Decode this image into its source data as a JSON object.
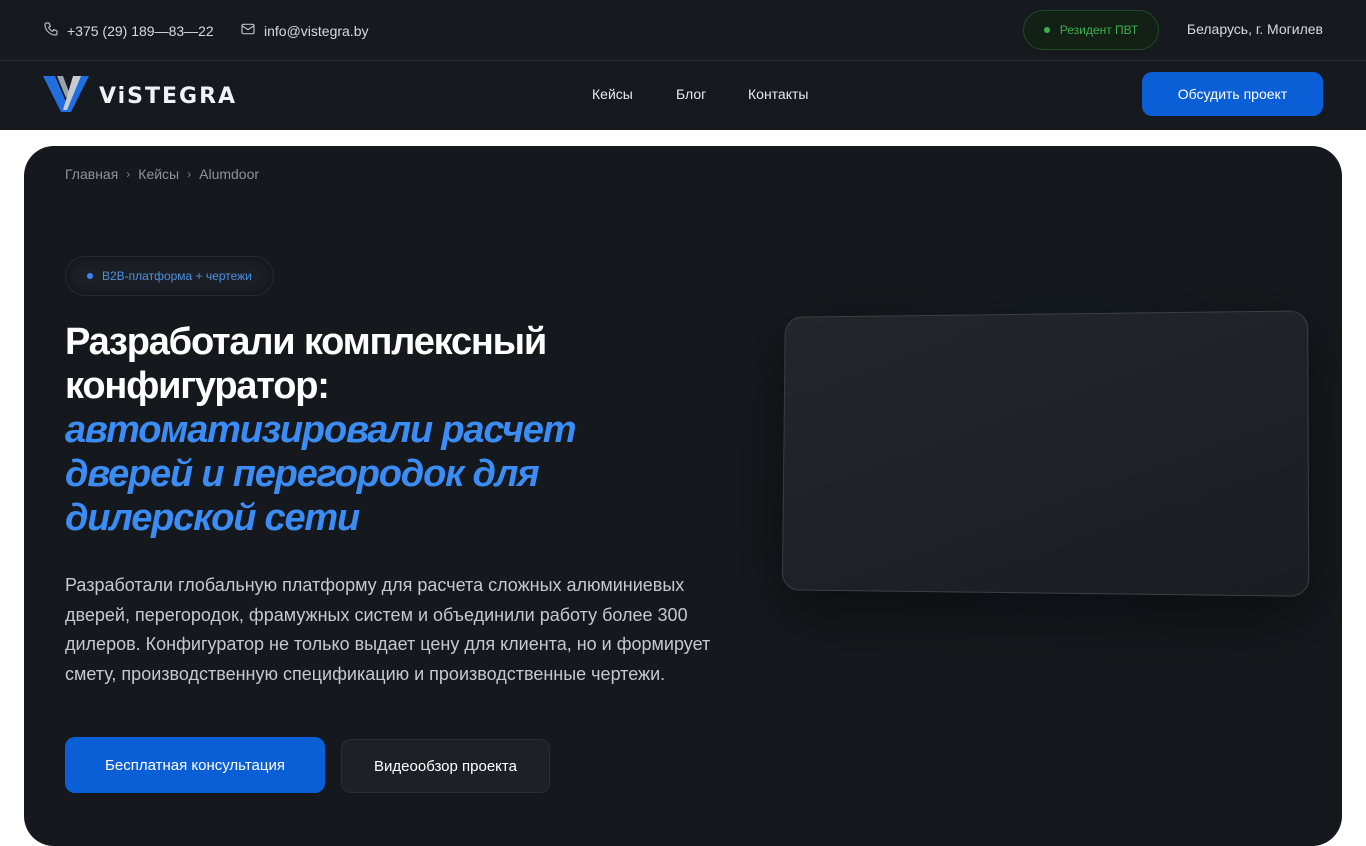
{
  "topbar": {
    "phone": "+375 (29) 189—83—22",
    "email": "info@vistegra.by",
    "resident_badge": "Резидент ПВТ",
    "location": "Беларусь, г. Могилев",
    "icons": {
      "phone": "phone-icon",
      "email": "mail-icon"
    },
    "colors": {
      "badge_text": "#3fae4f",
      "badge_dot": "#37b24d"
    }
  },
  "nav": {
    "logo_text": "ViSTEGRA",
    "links": [
      "Кейсы",
      "Блог",
      "Контакты"
    ],
    "cta_label": "Обсудить проект"
  },
  "hero": {
    "breadcrumb": [
      "Главная",
      "Кейсы",
      "Alumdoor"
    ],
    "tag": "B2B-платформа + чертежи",
    "title_white": "Разработали комплексный конфигуратор:",
    "title_blue": "автоматизировали расчет дверей и перегородок для дилерской сети",
    "description": "Разработали глобальную платформу для расчета сложных алюминиевых дверей, перегородок, фрамужных систем и объединили работу более 300 дилеров. Конфигуратор не только выдает цену для клиента, но и формирует смету, производственную спецификацию и производственные чертежи.",
    "btn_primary": "Бесплатная консультация",
    "btn_secondary": "Видеообзор проекта"
  },
  "colors": {
    "accent_blue": "#0b5fd6",
    "title_blue": "#3b8cf5",
    "background_dark": "#16191d"
  }
}
